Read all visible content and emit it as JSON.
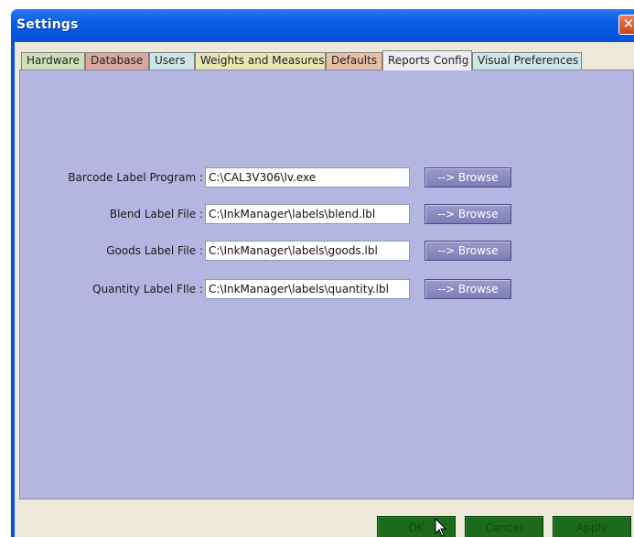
{
  "window": {
    "title": "Settings",
    "close_symbol": "✕"
  },
  "tabs": [
    {
      "label": "Hardware",
      "color": "#cfe0b8",
      "active": false
    },
    {
      "label": "Database",
      "color": "#d9a7a0",
      "active": false
    },
    {
      "label": "Users",
      "color": "#cce6e6",
      "active": false
    },
    {
      "label": "Weights and Measures",
      "color": "#e6e6b4",
      "active": false
    },
    {
      "label": "Defaults",
      "color": "#e8c0a8",
      "active": false
    },
    {
      "label": "Reports Config",
      "color": "#eeedf0",
      "active": true
    },
    {
      "label": "Visual Preferences",
      "color": "#cde6e8",
      "active": false
    }
  ],
  "reports": {
    "rows": [
      {
        "label": "Barcode Label Program :",
        "value": "C:\\CAL3V306\\lv.exe",
        "button": "--> Browse"
      },
      {
        "label": "Blend Label File :",
        "value": "C:\\InkManager\\labels\\blend.lbl",
        "button": "--> Browse"
      },
      {
        "label": "Goods Label File :",
        "value": "C:\\InkManager\\labels\\goods.lbl",
        "button": "--> Browse"
      },
      {
        "label": "Quantity Label FIle :",
        "value": "C:\\InkManager\\labels\\quantity.lbl",
        "button": "--> Browse"
      }
    ]
  },
  "footer": {
    "ok_label": "OK",
    "cancel_label": "Cancel",
    "apply_label": "Apply"
  },
  "colors": {
    "panel": "#b5b5e2",
    "titlebar": "#0a5ee6",
    "button_green": "#1c6a1c",
    "browse": "#8a8ac2"
  }
}
